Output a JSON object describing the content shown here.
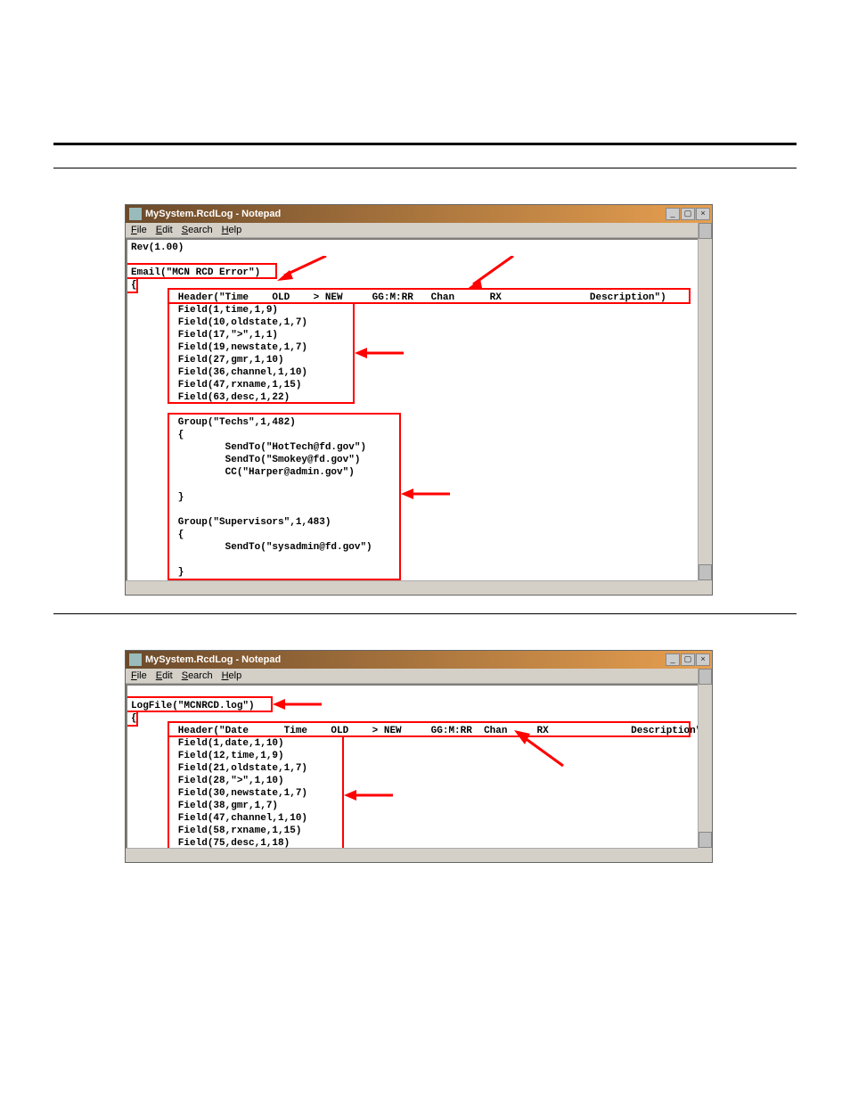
{
  "hr": {},
  "notepad1": {
    "title": "MySystem.RcdLog - Notepad",
    "menu": {
      "file": "File",
      "edit": "Edit",
      "search": "Search",
      "help": "Help"
    },
    "winbtns": {
      "min": "_",
      "max": "▢",
      "close": "×"
    },
    "code": "Rev(1.00)\n\nEmail(\"MCN RCD Error\")\n{\n        Header(\"Time    OLD    > NEW     GG:M:RR   Chan      RX               Description\")\n        Field(1,time,1,9)\n        Field(10,oldstate,1,7)\n        Field(17,\">\",1,1)\n        Field(19,newstate,1,7)\n        Field(27,gmr,1,10)\n        Field(36,channel,1,10)\n        Field(47,rxname,1,15)\n        Field(63,desc,1,22)\n\n        Group(\"Techs\",1,482)\n        {\n                SendTo(\"HotTech@fd.gov\")\n                SendTo(\"Smokey@fd.gov\")\n                CC(\"Harper@admin.gov\")\n\n        }\n\n        Group(\"Supervisors\",1,483)\n        {\n                SendTo(\"sysadmin@fd.gov\")\n\n        }\n\n}"
  },
  "notepad2": {
    "title": "MySystem.RcdLog - Notepad",
    "menu": {
      "file": "File",
      "edit": "Edit",
      "search": "Search",
      "help": "Help"
    },
    "winbtns": {
      "min": "_",
      "max": "▢",
      "close": "×"
    },
    "code": "\nLogFile(\"MCNRCD.log\")\n{\n        Header(\"Date      Time    OLD    > NEW     GG:M:RR  Chan     RX              Description\")\n        Field(1,date,1,10)\n        Field(12,time,1,9)\n        Field(21,oldstate,1,7)\n        Field(28,\">\",1,10)\n        Field(30,newstate,1,7)\n        Field(38,gmr,1,7)\n        Field(47,channel,1,10)\n        Field(58,rxname,1,15)\n        Field(75,desc,1,18)\n\n}"
  }
}
